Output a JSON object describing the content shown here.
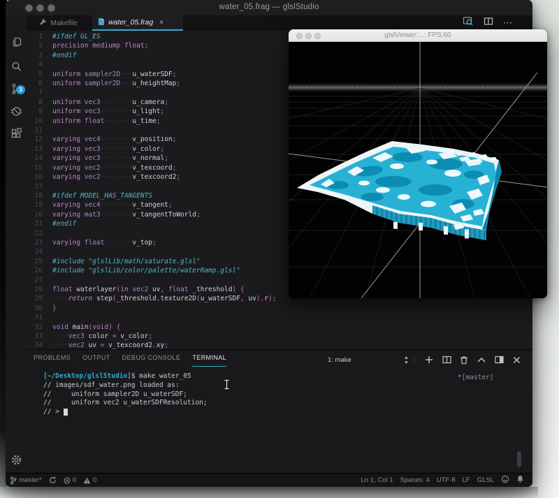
{
  "window": {
    "title": "water_05.frag — glslStudio"
  },
  "activity_bar": {
    "badge": "3",
    "icons": [
      "explorer-icon",
      "search-icon",
      "source-control-icon",
      "debug-disabled-icon",
      "extensions-icon",
      "gear-icon"
    ]
  },
  "tabs": [
    {
      "label": "Makefile",
      "icon": "wrench-icon"
    },
    {
      "label": "water_05.frag",
      "icon": "frag-file-icon",
      "close_glyph": "×",
      "active": true
    }
  ],
  "toolbar_icons": [
    "open-preview-icon",
    "split-editor-icon",
    "more-actions-icon"
  ],
  "editor": {
    "language": "GLSL",
    "lines": [
      [
        [
          "c",
          "#ifdef GL_ES"
        ]
      ],
      [
        [
          "k",
          "precision mediump float"
        ],
        [
          "p",
          ";"
        ]
      ],
      [
        [
          "c",
          "#endif"
        ]
      ],
      [],
      [
        [
          "k",
          "uniform "
        ],
        [
          "t",
          "sampler2D"
        ],
        [
          "ws",
          "···"
        ],
        [
          "i",
          "u_waterSDF"
        ],
        [
          "p",
          ";"
        ]
      ],
      [
        [
          "k",
          "uniform "
        ],
        [
          "t",
          "sampler2D"
        ],
        [
          "ws",
          "···"
        ],
        [
          "i",
          "u_heightMap"
        ],
        [
          "p",
          ";"
        ]
      ],
      [],
      [
        [
          "k",
          "uniform "
        ],
        [
          "t",
          "vec3"
        ],
        [
          "ws",
          "········"
        ],
        [
          "i",
          "u_camera"
        ],
        [
          "p",
          ";"
        ]
      ],
      [
        [
          "k",
          "uniform "
        ],
        [
          "t",
          "vec3"
        ],
        [
          "ws",
          "········"
        ],
        [
          "i",
          "u_light"
        ],
        [
          "p",
          ";"
        ]
      ],
      [
        [
          "k",
          "uniform "
        ],
        [
          "t",
          "float"
        ],
        [
          "ws",
          "·······"
        ],
        [
          "i",
          "u_time"
        ],
        [
          "p",
          ";"
        ]
      ],
      [],
      [
        [
          "k",
          "varying "
        ],
        [
          "t",
          "vec4"
        ],
        [
          "ws",
          "········"
        ],
        [
          "i",
          "v_position"
        ],
        [
          "p",
          ";"
        ]
      ],
      [
        [
          "k",
          "varying "
        ],
        [
          "t",
          "vec3"
        ],
        [
          "ws",
          "········"
        ],
        [
          "i",
          "v_color"
        ],
        [
          "p",
          ";"
        ]
      ],
      [
        [
          "k",
          "varying "
        ],
        [
          "t",
          "vec3"
        ],
        [
          "ws",
          "········"
        ],
        [
          "i",
          "v_normal"
        ],
        [
          "p",
          ";"
        ]
      ],
      [
        [
          "k",
          "varying "
        ],
        [
          "t",
          "vec2"
        ],
        [
          "ws",
          "········"
        ],
        [
          "i",
          "v_texcoord"
        ],
        [
          "p",
          ";"
        ]
      ],
      [
        [
          "k",
          "varying "
        ],
        [
          "t",
          "vec2"
        ],
        [
          "ws",
          "········"
        ],
        [
          "i",
          "v_texcoord2"
        ],
        [
          "p",
          ";"
        ]
      ],
      [],
      [
        [
          "c",
          "#ifdef MODEL_HAS_TANGENTS"
        ]
      ],
      [
        [
          "k",
          "varying "
        ],
        [
          "t",
          "vec4"
        ],
        [
          "ws",
          "········"
        ],
        [
          "i",
          "v_tangent"
        ],
        [
          "p",
          ";"
        ]
      ],
      [
        [
          "k",
          "varying "
        ],
        [
          "t",
          "mat3"
        ],
        [
          "ws",
          "········"
        ],
        [
          "i",
          "v_tangentToWorld"
        ],
        [
          "p",
          ";"
        ]
      ],
      [
        [
          "c",
          "#endif"
        ]
      ],
      [],
      [
        [
          "k",
          "varying "
        ],
        [
          "t",
          "float"
        ],
        [
          "ws",
          "·······"
        ],
        [
          "i",
          "v_top"
        ],
        [
          "p",
          ";"
        ]
      ],
      [],
      [
        [
          "c",
          "#include \"glslLib/math/saturate.glsl\""
        ]
      ],
      [
        [
          "c",
          "#include \"glslLib/color/palette/waterRamp.glsl\""
        ]
      ],
      [],
      [
        [
          "t",
          "float "
        ],
        [
          "i",
          "waterlayer"
        ],
        [
          "p",
          "("
        ],
        [
          "k",
          "in"
        ],
        [
          "t",
          " vec2"
        ],
        [
          "i",
          " uv"
        ],
        [
          "p",
          ","
        ],
        [
          "t",
          " float"
        ],
        [
          "i",
          " _threshold"
        ],
        [
          "p",
          ") {"
        ]
      ],
      [
        [
          "ws",
          "····"
        ],
        [
          "r",
          "return "
        ],
        [
          "i",
          "step"
        ],
        [
          "p",
          "("
        ],
        [
          "i",
          "_threshold"
        ],
        [
          "p",
          ","
        ],
        [
          "i",
          "texture2D"
        ],
        [
          "p",
          "("
        ],
        [
          "i",
          "u_waterSDF"
        ],
        [
          "p",
          ", "
        ],
        [
          "i",
          "uv"
        ],
        [
          "p",
          ")."
        ],
        [
          "i",
          "r"
        ],
        [
          "p",
          ");"
        ]
      ],
      [
        [
          "p",
          "}"
        ]
      ],
      [],
      [
        [
          "t",
          "void "
        ],
        [
          "i",
          "main"
        ],
        [
          "p",
          "("
        ],
        [
          "t",
          "void"
        ],
        [
          "p",
          ") {"
        ]
      ],
      [
        [
          "ws",
          "····"
        ],
        [
          "t",
          "vec3"
        ],
        [
          "i",
          " color "
        ],
        [
          "p",
          "= "
        ],
        [
          "i",
          "v_color"
        ],
        [
          "p",
          ";"
        ]
      ],
      [
        [
          "ws",
          "····"
        ],
        [
          "t",
          "vec2"
        ],
        [
          "i",
          " uv "
        ],
        [
          "p",
          "= "
        ],
        [
          "i",
          "v_texcoord2"
        ],
        [
          "p",
          "."
        ],
        [
          "i",
          "xy"
        ],
        [
          "p",
          ";"
        ]
      ]
    ]
  },
  "panel": {
    "tabs": [
      "PROBLEMS",
      "OUTPUT",
      "DEBUG CONSOLE",
      "TERMINAL"
    ],
    "active_tab": "TERMINAL",
    "terminal": {
      "select_label": "1: make",
      "lines": [
        [
          [
            "tpath",
            "[~/Desktop/glslStudio]"
          ],
          [
            "tw",
            "$ make water_05"
          ]
        ],
        [
          [
            "tw",
            "// images/sdf_water.png loaded as:"
          ]
        ],
        [
          [
            "tw",
            "//     uniform sampler2D u_waterSDF;"
          ]
        ],
        [
          [
            "tw",
            "//     uniform vec2 u_waterSDFResolution;"
          ]
        ],
        [
          [
            "tw",
            "// > "
          ],
          [
            "tcur",
            " "
          ]
        ]
      ],
      "scm": {
        "star": "*",
        "branch": "[master]"
      }
    }
  },
  "statusbar": {
    "branch_label": "master*",
    "error_count": "0",
    "warning_count": "0",
    "right": [
      "Ln 1, Col 1",
      "Spaces: 4",
      "UTF-8",
      "LF",
      "GLSL"
    ]
  },
  "viewer": {
    "title": "glslViewer:...: FPS:60"
  },
  "colors": {
    "accent": "#39aac8",
    "badge": "#2f99d4",
    "keyword": "#bd86c9",
    "punctuation": "#d8679f",
    "preprocessor": "#4cb8cc",
    "water_top": "#27b1d4",
    "water_deep": "#0d8cb2",
    "water_side": "#1792b6",
    "foam": "#eef8fa"
  }
}
